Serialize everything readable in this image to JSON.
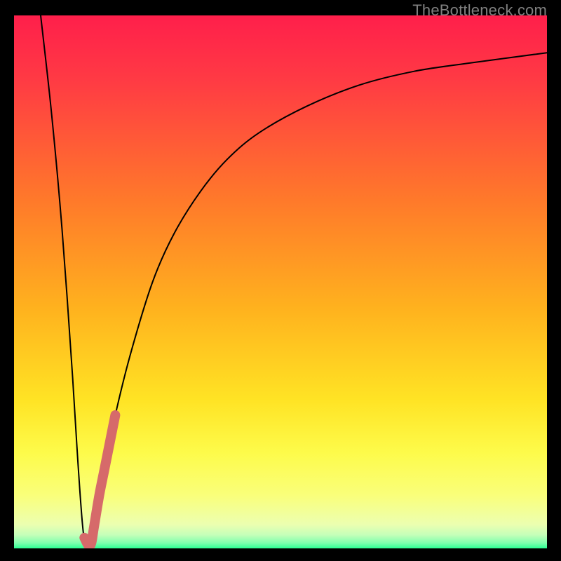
{
  "watermark": "TheBottleneck.com",
  "gradient": {
    "stops": [
      {
        "pos": 0.0,
        "color": "#ff1f4b"
      },
      {
        "pos": 0.12,
        "color": "#ff3a44"
      },
      {
        "pos": 0.35,
        "color": "#ff7a2a"
      },
      {
        "pos": 0.55,
        "color": "#ffb21e"
      },
      {
        "pos": 0.72,
        "color": "#ffe324"
      },
      {
        "pos": 0.82,
        "color": "#fdfb4a"
      },
      {
        "pos": 0.9,
        "color": "#faff7a"
      },
      {
        "pos": 0.955,
        "color": "#ecffb0"
      },
      {
        "pos": 0.975,
        "color": "#c4ffb9"
      },
      {
        "pos": 0.99,
        "color": "#7dffad"
      },
      {
        "pos": 1.0,
        "color": "#2bff93"
      }
    ]
  },
  "chart_data": {
    "type": "line",
    "xlim": [
      0,
      100
    ],
    "ylim": [
      0,
      100
    ],
    "title": "",
    "xlabel": "",
    "ylabel": "",
    "series": [
      {
        "name": "bottleneck-curve",
        "color": "#000000",
        "x": [
          5,
          7,
          9,
          11,
          12,
          13,
          14,
          15,
          17,
          19,
          22,
          26,
          30,
          35,
          40,
          46,
          55,
          65,
          75,
          85,
          100
        ],
        "y": [
          100,
          82,
          60,
          32,
          16,
          3,
          0,
          4,
          15,
          25,
          37,
          50,
          59,
          67,
          73,
          78,
          83,
          87,
          89.5,
          91,
          93
        ]
      }
    ],
    "highlight": {
      "name": "highlight-segment",
      "color": "#d66a6a",
      "x": [
        13.2,
        14,
        14.5,
        15,
        16,
        17,
        18,
        19
      ],
      "y": [
        2,
        0.5,
        1,
        4,
        10,
        15,
        20,
        25
      ]
    }
  }
}
